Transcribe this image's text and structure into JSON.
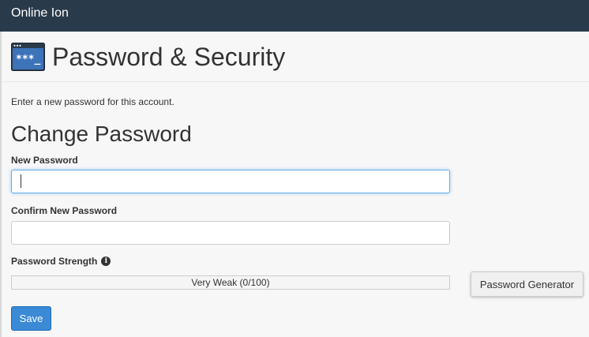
{
  "app": {
    "title": "Online Ion"
  },
  "header": {
    "title": "Password & Security",
    "icon": "password-terminal-icon"
  },
  "intro_text": "Enter a new password for this account.",
  "section": {
    "title": "Change Password"
  },
  "fields": {
    "new_password": {
      "label": "New Password",
      "value": "",
      "placeholder": ""
    },
    "confirm_password": {
      "label": "Confirm New Password",
      "value": "",
      "placeholder": ""
    }
  },
  "strength": {
    "label": "Password Strength",
    "info_icon": "info-circle-icon",
    "text": "Very Weak (0/100)",
    "score": 0,
    "max": 100
  },
  "buttons": {
    "generator": "Password Generator",
    "save": "Save"
  },
  "colors": {
    "topbar": "#293a4a",
    "save_button": "#3a8ad6",
    "focus_border": "#66afe9"
  }
}
